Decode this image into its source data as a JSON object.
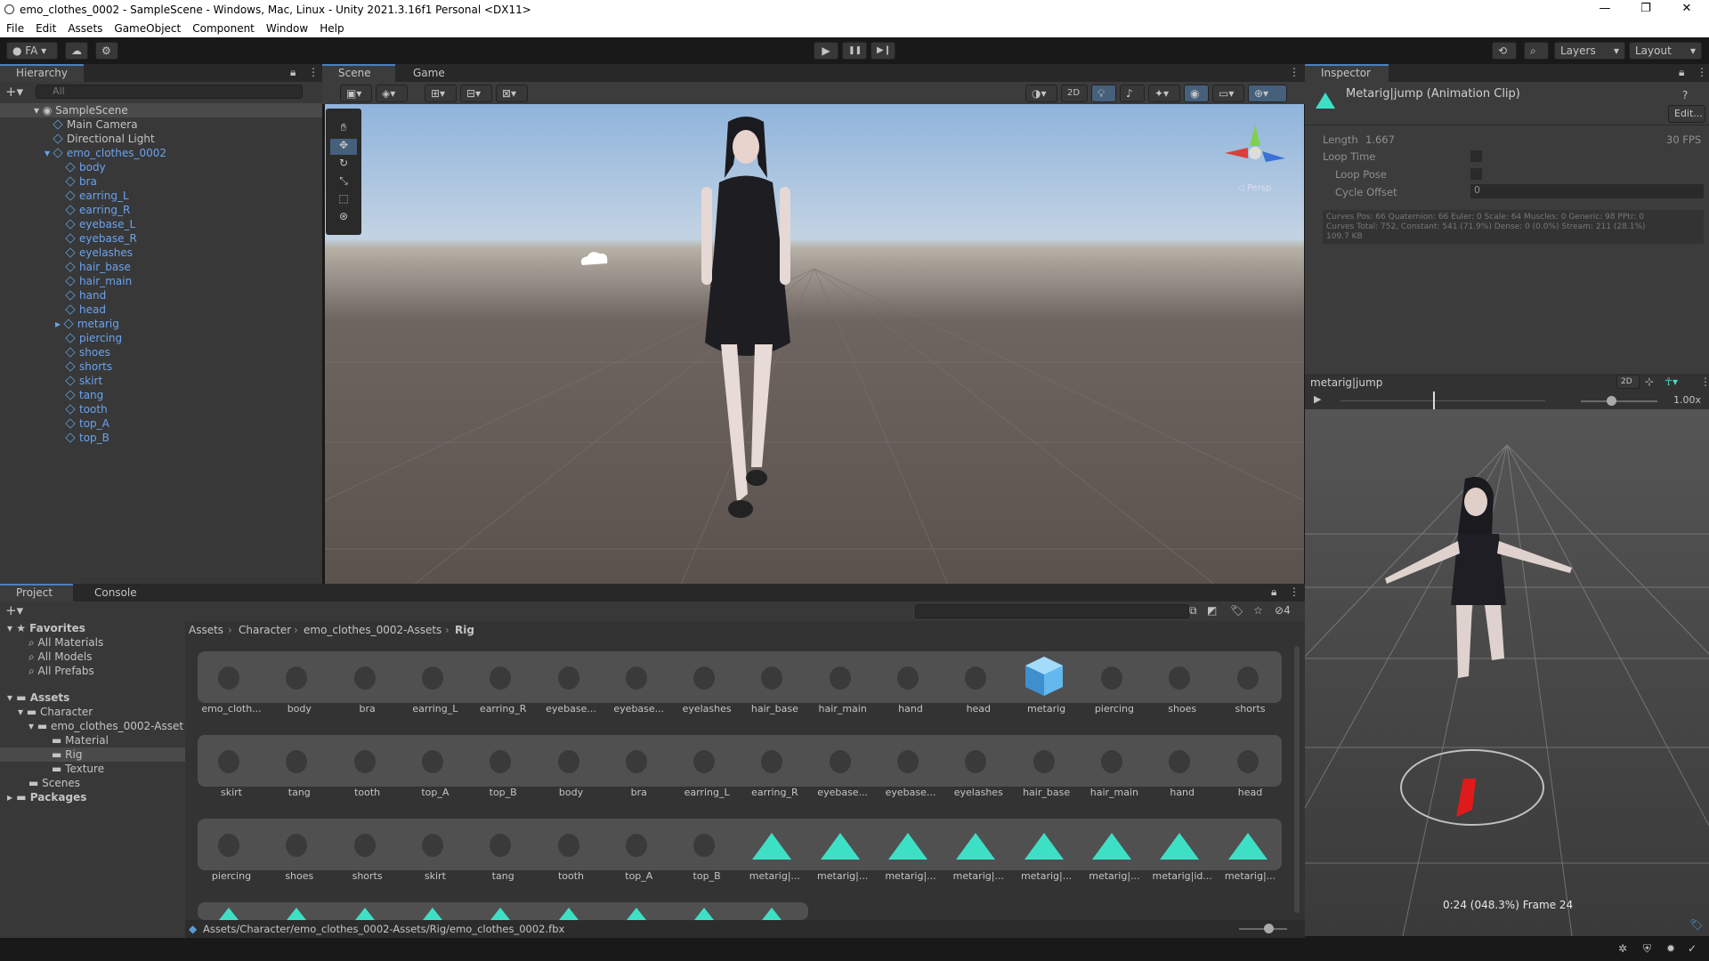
{
  "window": {
    "title": "emo_clothes_0002 - SampleScene - Windows, Mac, Linux - Unity 2021.3.16f1 Personal <DX11>",
    "min": "—",
    "max": "❐",
    "close": "✕"
  },
  "menu": [
    "File",
    "Edit",
    "Assets",
    "GameObject",
    "Component",
    "Window",
    "Help"
  ],
  "toolbar": {
    "account": "FA",
    "layers": "Layers",
    "layout": "Layout",
    "play": "▶",
    "pause": "❚❚",
    "step": "▶❙"
  },
  "hierarchy": {
    "tab": "Hierarchy",
    "search_placeholder": "All",
    "scene": "SampleScene",
    "items": [
      "Main Camera",
      "Directional Light"
    ],
    "root": "emo_clothes_0002",
    "children": [
      "body",
      "bra",
      "earring_L",
      "earring_R",
      "eyebase_L",
      "eyebase_R",
      "eyelashes",
      "hair_base",
      "hair_main",
      "hand",
      "head",
      "metarig",
      "piercing",
      "shoes",
      "shorts",
      "skirt",
      "tang",
      "tooth",
      "top_A",
      "top_B"
    ]
  },
  "scene": {
    "tabs": [
      "Scene",
      "Game"
    ],
    "mode2d": "2D",
    "persp": "◁ Persp"
  },
  "inspector": {
    "tab": "Inspector",
    "title": "Metarig|jump (Animation Clip)",
    "edit": "Edit...",
    "length_label": "Length",
    "length": "1.667",
    "fps": "30 FPS",
    "loop_time": "Loop Time",
    "loop_pose": "Loop Pose",
    "cycle_offset": "Cycle Offset",
    "cycle_value": "0",
    "curves1": "Curves Pos: 66 Quaternion: 66 Euler: 0 Scale: 64 Muscles: 0 Generic: 98 PPtr: 0",
    "curves2": "Curves Total: 752, Constant: 541 (71.9%) Dense: 0 (0.0%) Stream: 211 (28.1%)",
    "curves3": "109.7 KB"
  },
  "preview": {
    "name": "metarig|jump",
    "mode2d": "2D",
    "speed": "1.00x",
    "time_fraction": 0.45,
    "speed_fraction": 0.4,
    "status": "0:24 (048.3%) Frame 24"
  },
  "project": {
    "tabs": [
      "Project",
      "Console"
    ],
    "count": "4",
    "favorites": "Favorites",
    "fav_items": [
      "All Materials",
      "All Models",
      "All Prefabs"
    ],
    "assets": "Assets",
    "character": "Character",
    "asset_folder": "emo_clothes_0002-Asset",
    "sub": [
      "Material",
      "Rig",
      "Texture"
    ],
    "scenes": "Scenes",
    "packages": "Packages",
    "breadcrumb": [
      "Assets",
      "Character",
      "emo_clothes_0002-Assets",
      "Rig"
    ],
    "row1": [
      "emo_cloth...",
      "body",
      "bra",
      "earring_L",
      "earring_R",
      "eyebase...",
      "eyebase...",
      "eyelashes",
      "hair_base",
      "hair_main",
      "hand",
      "head",
      "metarig",
      "piercing",
      "shoes",
      "shorts"
    ],
    "row2": [
      "skirt",
      "tang",
      "tooth",
      "top_A",
      "top_B",
      "body",
      "bra",
      "earring_L",
      "earring_R",
      "eyebase...",
      "eyebase...",
      "eyelashes",
      "hair_base",
      "hair_main",
      "hand",
      "head"
    ],
    "row3": [
      "piercing",
      "shoes",
      "shorts",
      "skirt",
      "tang",
      "tooth",
      "top_A",
      "top_B",
      "metarig|...",
      "metarig|...",
      "metarig|...",
      "metarig|...",
      "metarig|...",
      "metarig|...",
      "metarig|id...",
      "metarig|..."
    ],
    "path": "Assets/Character/emo_clothes_0002-Assets/Rig/emo_clothes_0002.fbx"
  },
  "colors": {
    "accent": "#4c7fc2",
    "prefab": "#6aa3ef",
    "anim": "#3ee0c5"
  }
}
